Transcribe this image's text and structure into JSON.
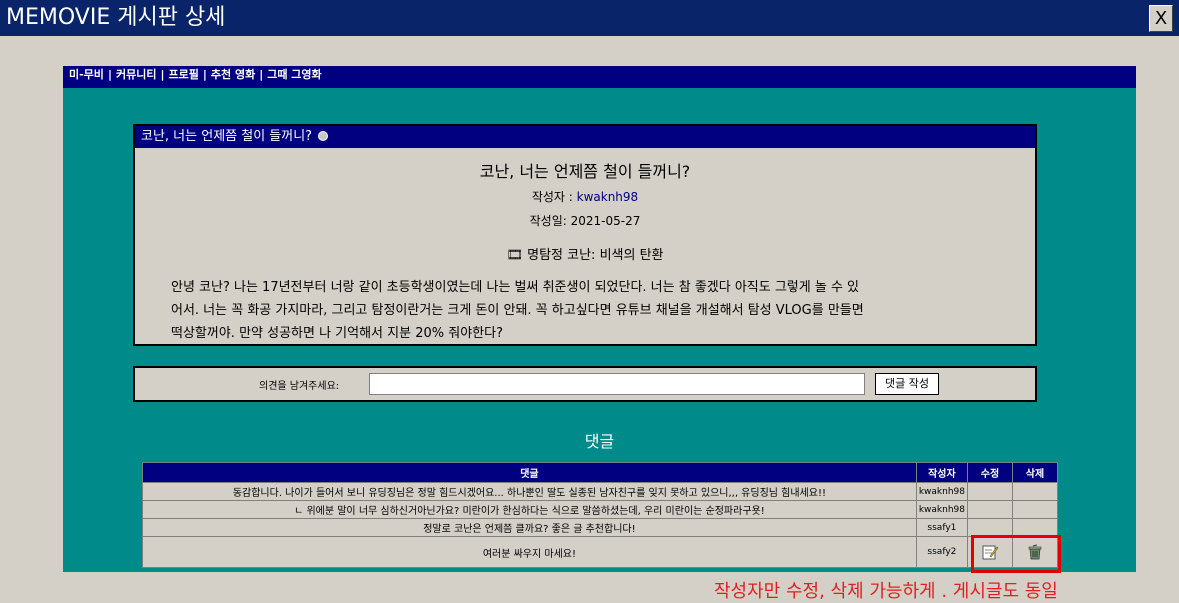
{
  "window": {
    "title": "MEMOVIE 게시판 상세",
    "close_label": "X"
  },
  "nav": {
    "items": [
      "미-무비",
      "커뮤니티",
      "프로필",
      "추천 영화",
      "그때 그영화"
    ]
  },
  "post": {
    "panel_title": "코난, 너는 언제쯤 철이 들꺼니?",
    "heading": "코난, 너는 언제쯤 철이 들꺼니?",
    "author_label": "작성자 :",
    "author": "kwaknh98",
    "date_label": "작성일: 2021-05-27",
    "movie": "🎞 명탐정 코난: 비색의 탄환",
    "body_lines": [
      "안녕 코난? 나는 17년전부터 너랑 같이 초등학생이였는데 나는 벌써 취준생이 되었단다. 너는 참 좋겠다 아직도 그렇게 놀 수 있",
      "어서. 너는 꼭 화공 가지마라, 그리고 탐정이란거는 크게 돈이 안돼. 꼭 하고싶다면 유튜브 채널을 개설해서 탐성 VLOG를 만들면",
      "떡상할꺼야. 만약 성공하면 나 기억해서 지분 20% 줘야한다?"
    ]
  },
  "comment_form": {
    "label": "의견을 남겨주세요:",
    "placeholder": "",
    "submit_label": "댓글 작성"
  },
  "comments": {
    "heading": "댓글",
    "columns": [
      "댓글",
      "작성자",
      "수정",
      "삭제"
    ],
    "rows": [
      {
        "text": "동감합니다. 나이가 들어서 보니 유딩징님은 정말 힘드시겠어요... 하나뿐인 딸도 실종된 남자친구를 잊지 못하고 있으니,,, 유딩징님 힘내세요!!",
        "author": "kwaknh98"
      },
      {
        "text": "ㄴ 위에분 말이 너무 심하신거아닌가요? 미란이가 한심하다는 식으로 말씀하셨는데, 우리 미란이는 순정파라구욧!",
        "author": "kwaknh98"
      },
      {
        "text": "정말로 코난은 언제쯤 클까요? 좋은 글 추천합니다!",
        "author": "ssafy1"
      },
      {
        "text": "여러분 싸우지 마세요!",
        "author": "ssafy2"
      }
    ]
  },
  "annotation": {
    "note": "작성자만 수정, 삭제 가능하게 . 게시글도 동일",
    "color": "#e02020"
  }
}
